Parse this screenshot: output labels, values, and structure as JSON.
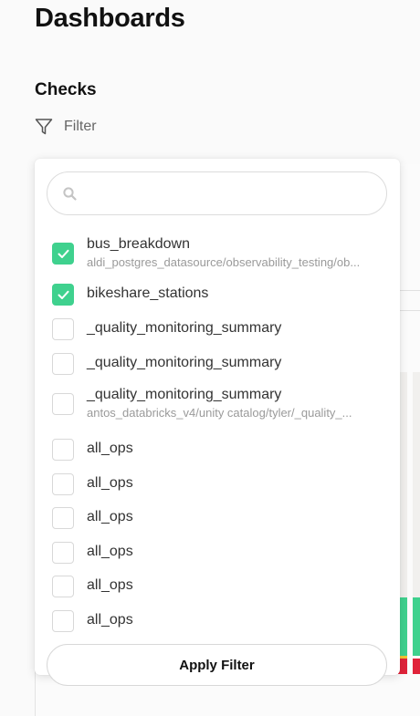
{
  "page": {
    "title": "Dashboards",
    "section_title": "Checks",
    "filter_label": "Filter"
  },
  "dropdown": {
    "search": {
      "value": "",
      "placeholder": ""
    },
    "options": [
      {
        "name": "bus_breakdown",
        "path": "aldi_postgres_datasource/observability_testing/ob...",
        "checked": true
      },
      {
        "name": "bikeshare_stations",
        "path": "",
        "checked": true
      },
      {
        "name": "_quality_monitoring_summary",
        "path": "",
        "checked": false
      },
      {
        "name": "_quality_monitoring_summary",
        "path": "",
        "checked": false
      },
      {
        "name": "_quality_monitoring_summary",
        "path": "antos_databricks_v4/unity catalog/tyler/_quality_...",
        "checked": false
      },
      {
        "name": "all_ops",
        "path": "",
        "checked": false
      },
      {
        "name": "all_ops",
        "path": "",
        "checked": false
      },
      {
        "name": "all_ops",
        "path": "",
        "checked": false
      },
      {
        "name": "all_ops",
        "path": "",
        "checked": false
      },
      {
        "name": "all_ops",
        "path": "",
        "checked": false
      },
      {
        "name": "all_ops",
        "path": "",
        "checked": false
      }
    ],
    "apply_label": "Apply Filter"
  },
  "colors": {
    "accent_green": "#3fd18e",
    "status_red": "#e0233a",
    "status_yellow": "#f4c430"
  },
  "icons": {
    "filter": "filter-funnel-icon",
    "search": "search-icon",
    "check": "checkmark-icon"
  }
}
